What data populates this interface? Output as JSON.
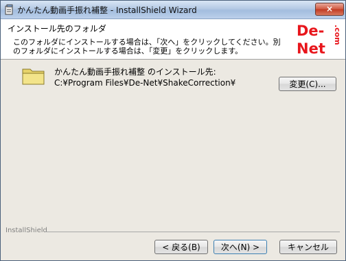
{
  "window": {
    "title": "かんたん動画手振れ補整 - InstallShield Wizard",
    "close_label": "×"
  },
  "header": {
    "title": "インストール先のフォルダ",
    "description": "このフォルダにインストールする場合は、「次へ」をクリックしてください。別のフォルダにインストールする場合は、「変更」をクリックします。",
    "logo_text_main": "De-Net",
    "logo_text_side": ".com"
  },
  "main": {
    "install_label": "かんたん動画手振れ補整 のインストール先:",
    "install_path": "C:¥Program Files¥De-Net¥ShakeCorrection¥",
    "change_button": "変更(C)..."
  },
  "footer": {
    "brand": "InstallShield",
    "back_button": "< 戻る(B)",
    "next_button": "次へ(N) >",
    "cancel_button": "キャンセル"
  },
  "colors": {
    "logo_red": "#e8161c",
    "header_bg": "#ffffff",
    "dialog_bg": "#ece9e2"
  }
}
